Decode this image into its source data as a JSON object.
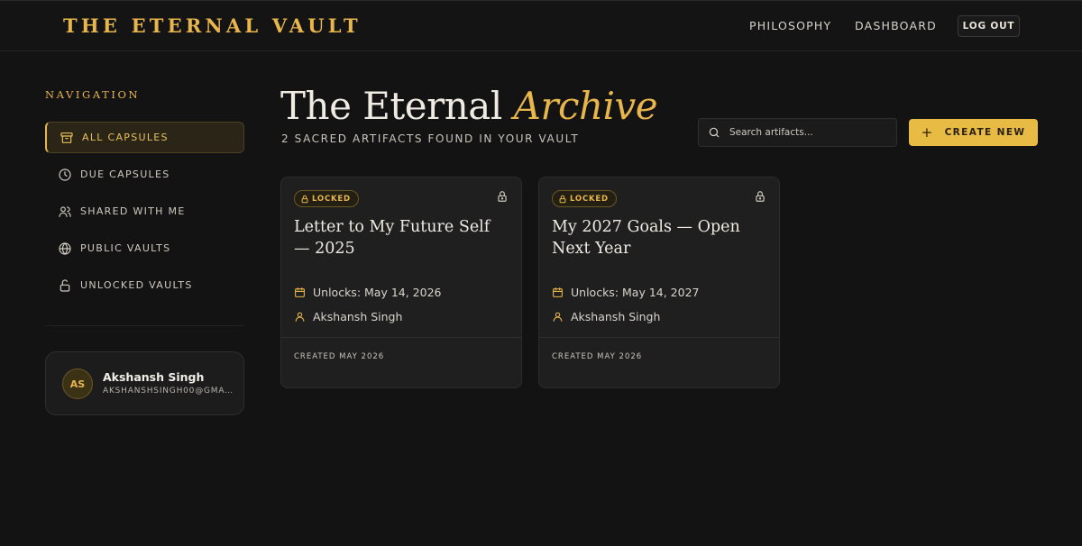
{
  "header": {
    "brand": "THE ETERNAL VAULT",
    "nav": [
      "PHILOSOPHY",
      "DASHBOARD"
    ],
    "logout_label": "LOG OUT"
  },
  "sidebar": {
    "heading": "NAVIGATION",
    "items": [
      {
        "label": "ALL CAPSULES",
        "icon": "archive-icon",
        "active": true
      },
      {
        "label": "DUE CAPSULES",
        "icon": "clock-icon",
        "active": false
      },
      {
        "label": "SHARED WITH ME",
        "icon": "users-icon",
        "active": false
      },
      {
        "label": "PUBLIC VAULTS",
        "icon": "globe-icon",
        "active": false
      },
      {
        "label": "UNLOCKED VAULTS",
        "icon": "unlock-icon",
        "active": false
      }
    ],
    "user": {
      "initials": "AS",
      "name": "Akshansh Singh",
      "email": "AKSHANSHSINGH00@GMA..."
    }
  },
  "main": {
    "title_plain": "The Eternal",
    "title_accent": "Archive",
    "subtitle": "2 SACRED ARTIFACTS FOUND IN YOUR VAULT",
    "search_placeholder": "Search artifacts...",
    "create_label": "CREATE NEW",
    "cards": [
      {
        "badge": "LOCKED",
        "title": "Letter to My Future Self — 2025",
        "unlocks": "Unlocks: May 14, 2026",
        "author": "Akshansh Singh",
        "created": "CREATED MAY 2026"
      },
      {
        "badge": "LOCKED",
        "title": "My 2027 Goals — Open Next Year",
        "unlocks": "Unlocks: May 14, 2027",
        "author": "Akshansh Singh",
        "created": "CREATED MAY 2026"
      }
    ]
  },
  "colors": {
    "background": "#131313",
    "accent": "#e8b64a",
    "card": "#1f1f1f"
  }
}
